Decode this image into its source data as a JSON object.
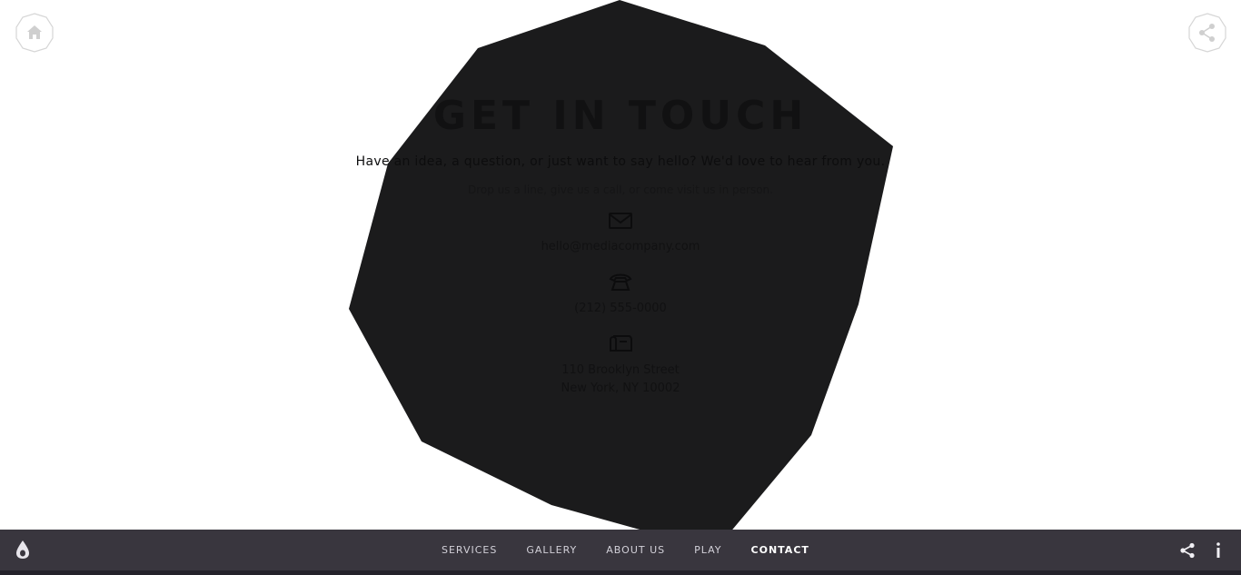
{
  "header": {
    "home_icon": "home-icon",
    "share_icon": "share-icon"
  },
  "contact": {
    "title": "GET IN TOUCH",
    "subtitle": "Have an idea, a question, or just want to say hello? We'd love to hear from you.",
    "note": "Drop us a line, give us a call, or come visit us in person.",
    "email": "hello@mediacompany.com",
    "phone": "(212) 555-0000",
    "address_line1": "110 Brooklyn Street",
    "address_line2": "New York, NY 10002",
    "icons": [
      "envelope-icon",
      "phone-icon",
      "mailbox-icon"
    ]
  },
  "bottom_bar": {
    "nav": [
      {
        "label": "SERVICES"
      },
      {
        "label": "GALLERY"
      },
      {
        "label": "ABOUT US"
      },
      {
        "label": "PLAY"
      },
      {
        "label": "CONTACT",
        "active": true
      }
    ],
    "logo_icon": "drop-logo-icon",
    "share_icon": "share-icon",
    "more_icon": "more-vertical-icon"
  },
  "colors": {
    "background": "#ffffff",
    "blob": "#1b1b1c",
    "bar": "#39363e",
    "nav_text": "#d2d0d8",
    "nav_active": "#ffffff"
  }
}
